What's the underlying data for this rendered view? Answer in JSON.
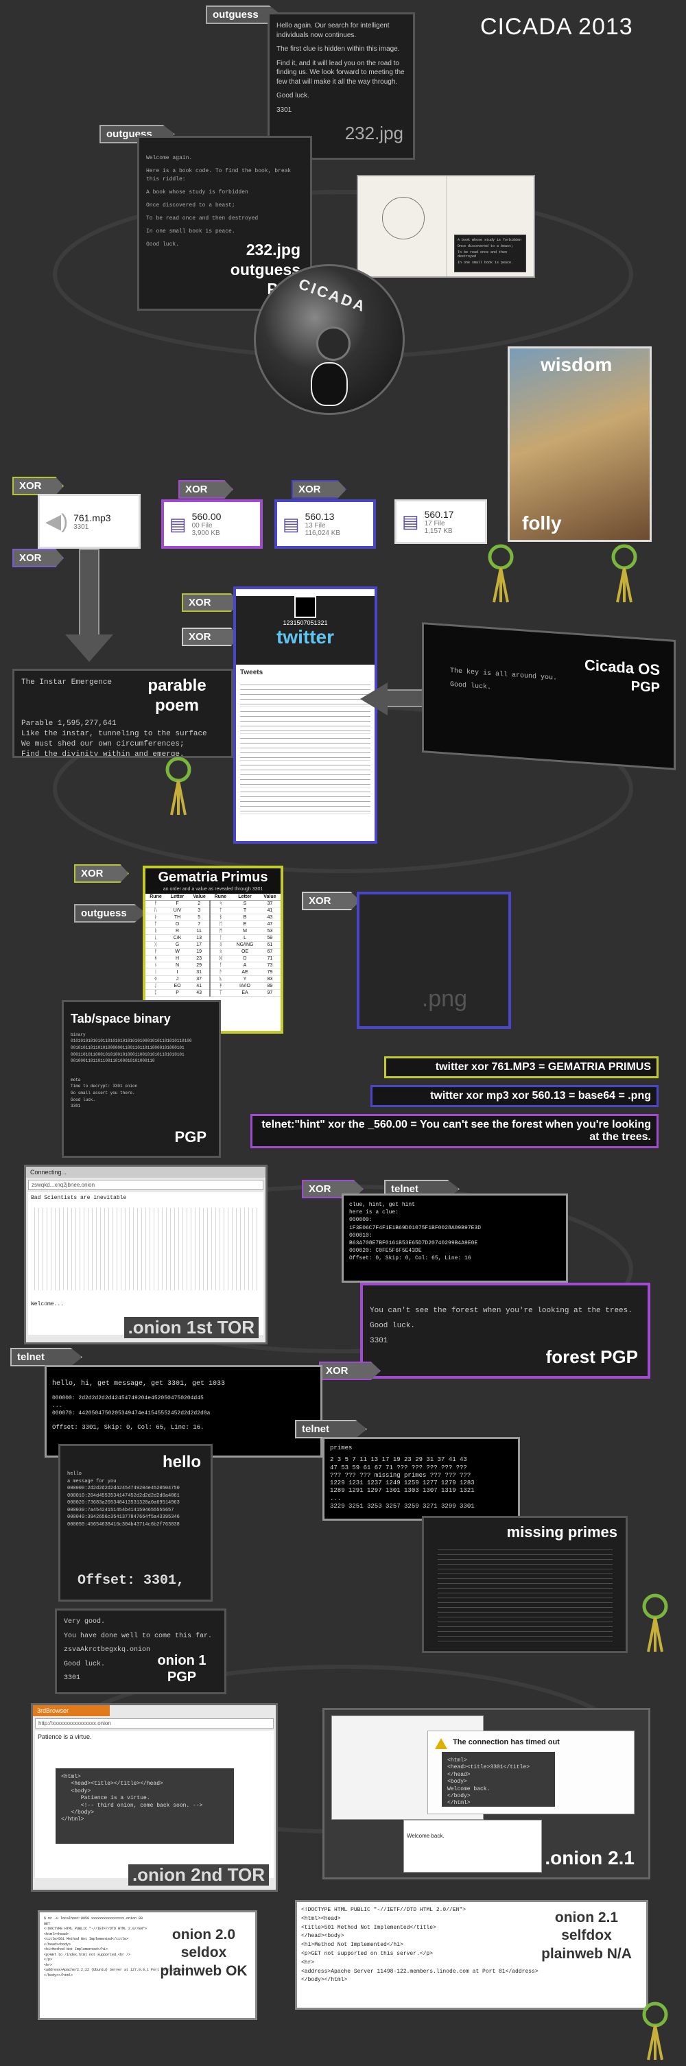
{
  "title": "CICADA 2013",
  "tags": {
    "outguess": "outguess",
    "xor": "XOR",
    "telnet": "telnet"
  },
  "start_panel": {
    "lines": [
      "Hello again.  Our search for intelligent individuals now continues.",
      "The first clue is hidden within this image.",
      "Find it, and it will lead you on the road to finding us.  We look forward to meeting the few that will make it all the way through.",
      "Good luck.",
      "3301"
    ],
    "filename": "232.jpg"
  },
  "pgp1": {
    "lines": [
      "Welcome again.",
      "Here is a book code.  To find the book, break this riddle:",
      "A book whose study is forbidden",
      "Once discovered to a beast;",
      "To be read once and then destroyed",
      "In one small book is peace.",
      "Good luck."
    ],
    "caption": "232.jpg outguess PGP"
  },
  "book_page": {
    "lines": [
      "A book whose study is forbidden",
      "Once discovered to a beast;",
      "To be read once and then destroyed",
      "In one small book is peace."
    ]
  },
  "cd_label": "CICADA",
  "painting": {
    "top": "wisdom",
    "bottom": "folly"
  },
  "files": [
    {
      "name": "761.mp3",
      "meta1": "3301",
      "meta2": ""
    },
    {
      "name": "560.00",
      "meta1": "00 File",
      "meta2": "3,900 KB"
    },
    {
      "name": "560.13",
      "meta1": "13 File",
      "meta2": "116,024 KB"
    },
    {
      "name": "560.17",
      "meta1": "17 File",
      "meta2": "1,157 KB"
    }
  ],
  "parable": {
    "heading": "The Instar Emergence",
    "caption": "parable poem",
    "lines": [
      "Parable 1,595,277,641",
      "Like the instar, tunneling to the surface",
      "We must shed our own circumferences;",
      "Find the divinity within and emerge."
    ]
  },
  "twitter": {
    "handle": "1231507051321",
    "logo": "twitter",
    "section": "Tweets"
  },
  "cicada_os": {
    "title": "Cicada OS",
    "line": "The key is all around you.",
    "line2": "Good luck.",
    "pgp": "PGP"
  },
  "gematria": {
    "title": "Gematria Primus",
    "subtitle": "an order and a value as revealed through 3301",
    "headers": [
      "Rune",
      "Letter",
      "Value",
      "Rune",
      "Letter",
      "Value"
    ],
    "rows": [
      [
        "ᚠ",
        "F",
        "2",
        "ᛋ",
        "S",
        "37"
      ],
      [
        "ᚢ",
        "U/V",
        "3",
        "ᛏ",
        "T",
        "41"
      ],
      [
        "ᚦ",
        "TH",
        "5",
        "ᛒ",
        "B",
        "43"
      ],
      [
        "ᚩ",
        "O",
        "7",
        "ᛖ",
        "E",
        "47"
      ],
      [
        "ᚱ",
        "R",
        "11",
        "ᛗ",
        "M",
        "53"
      ],
      [
        "ᚳ",
        "C/K",
        "13",
        "ᛚ",
        "L",
        "59"
      ],
      [
        "ᚷ",
        "G",
        "17",
        "ᛝ",
        "NG/ING",
        "61"
      ],
      [
        "ᚹ",
        "W",
        "19",
        "ᛟ",
        "OE",
        "67"
      ],
      [
        "ᚻ",
        "H",
        "23",
        "ᛞ",
        "D",
        "71"
      ],
      [
        "ᚾ",
        "N",
        "29",
        "ᚪ",
        "A",
        "73"
      ],
      [
        "ᛁ",
        "I",
        "31",
        "ᚫ",
        "AE",
        "79"
      ],
      [
        "ᛄ",
        "J",
        "37",
        "ᚣ",
        "Y",
        "83"
      ],
      [
        "ᛇ",
        "EO",
        "41",
        "ᛡ",
        "IA/IO",
        "89"
      ],
      [
        "ᛈ",
        "P",
        "43",
        "ᛠ",
        "EA",
        "97"
      ]
    ]
  },
  "png_box": {
    "label": ".png"
  },
  "tabspace": {
    "title": "Tab/space binary",
    "label": "binary",
    "lines": [
      "0101010101010110101010101010100010101101010110100",
      "0010101101101010000001100110110110000101000101",
      "0001101011000101010010100011001010101101010101",
      "0010001101101100110100010101000110"
    ],
    "foot": [
      "meta",
      "Time to decrypt: 3301 onion",
      "Go small assert you there.",
      "Good luck.",
      "3301"
    ],
    "pgp": "PGP"
  },
  "equations": [
    "twitter xor 761.MP3 = GEMATRIA PRIMUS",
    "twitter xor mp3 xor 560.13 = base64 = .png",
    "telnet:\"hint\"  xor the _560.00 =  You can't see the forest when you're looking at the trees."
  ],
  "onion1": {
    "tab": "Connecting...",
    "url": "zswqkd...xnq2jbnee.onion",
    "heading": "Bad Scientists are inevitable",
    "footer": "Welcome...",
    "caption": ".onion 1st TOR"
  },
  "telnet_hint": {
    "lines": [
      "clue, hint, get hint",
      "here is a clue:",
      "000000:",
      "1F3E06C7F4F1E1B69D01075F1BF0028A09B97E3D",
      "000010:",
      "B63A708E7BF0161B53E65D7D20740299B4A9E0E",
      "000020: C0FE5F6F5E43DE",
      "Offset: 0, Skip: 0, Col: 65, Line: 16"
    ]
  },
  "forest": {
    "lines": [
      "You can't see the forest when you're looking at the trees.",
      "Good luck.",
      "3301"
    ],
    "caption": "forest PGP"
  },
  "telnet_hello": {
    "lines": [
      "hello, hi, get message, get 3301, get 1033",
      "000000: 2d2d2d2d2d42454749204e4520504750204d45",
      "...",
      "000070: 4420504750205349474e41545552452d2d2d2d0a",
      "Offset: 3301, Skip: 0, Col: 65, Line: 16."
    ]
  },
  "hello_dump": {
    "caption": "hello",
    "lines": [
      "hello",
      "a message for you",
      "000000:2d2d2d2d2d42454749204e4520504750",
      "000010:204d4553534147452d2d2d2d2d0a4861",
      "000020:73683a205348413531320a0a69514963",
      "000030:7a45424151454b4141594655555657",
      "000040:3942656c3541377847664f5a43395346",
      "000050:45654638416c304b43714c6b2f763038"
    ],
    "offset": "Offset: 3301,"
  },
  "primes": {
    "header": "primes",
    "lines": [
      "2 3 5 7 11 13 17 19 23 29  31 37 41 43",
      "47 53 59 61 67 71 ??? ??? ??? ??? ???",
      "??? ??? ??? missing primes ??? ??? ???",
      "1229 1231 1237 1249 1259 1277 1279 1283",
      "1289 1291 1297 1301 1303 1307 1319 1321",
      "...",
      "3229 3251 3253 3257  3259 3271 3299 3301"
    ],
    "caption": "missing primes"
  },
  "onion1pgp": {
    "lines": [
      "Very good.",
      "You have done well to come this far.",
      "zsvaAkrctbegxkq.onion",
      "Good luck.",
      "3301"
    ],
    "caption": "onion 1 PGP"
  },
  "onion2": {
    "tab": "3rdBrowser",
    "url": "http://xxxxxxxxxxxxxxxx.onion",
    "line": "Patience is a virtue.",
    "code": [
      "<html>",
      "   <head><title></title></head>",
      "   <body>",
      "      Patience is a virtue.",
      "      <!-- third onion, come back soon. -->",
      "   </body>",
      "</html>"
    ],
    "caption": ".onion 2nd TOR"
  },
  "onion21": {
    "timeout": "The connection has timed out",
    "code": [
      "<html>",
      "<head><title>3301</title></head>",
      "<body>",
      "Welcome back.",
      "</body>",
      "</html>"
    ],
    "welcome": "Welcome back.",
    "caption": ".onion 2.1"
  },
  "onion20": {
    "lines": [
      "$ nc -u localhost:8050 xxxxxxxxxxxxxxxx.onion 80",
      "GET",
      "",
      "<!DOCTYPE HTML PUBLIC \"-//IETF//DTD HTML 2.0//EN\">",
      "<html><head>",
      "<title>501 Method Not Implemented</title>",
      "</head><body>",
      "<h1>Method Not Implemented</h1>",
      "<p>GET to /index.html not supported.<br />",
      "</p>",
      "<hr>",
      "<address>Apache/2.2.22 (Ubuntu) Server at 127.0.0.1 Port 80</address>",
      "</body></html>"
    ],
    "caption": "onion 2.0 seldox plainweb OK"
  },
  "onion21b": {
    "lines": [
      "<!DOCTYPE HTML PUBLIC \"-//IETF//DTD HTML 2.0//EN\">",
      "<html><head>",
      "<title>501 Method Not Implemented</title>",
      "</head><body>",
      "<h1>Method Not Implemented</h1>",
      "<p>GET not supported on this server.</p>",
      "<hr>",
      "<address>Apache Server 11498-122.members.linode.com at Port 81</address>",
      "</body></html>"
    ],
    "caption": "onion 2.1 selfdox plainweb N/A"
  }
}
